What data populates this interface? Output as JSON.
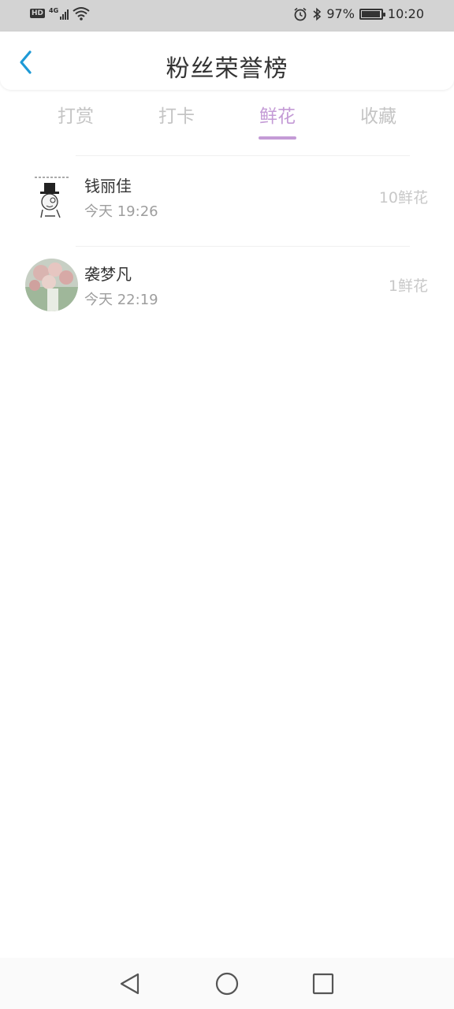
{
  "status_bar": {
    "hd": "HD",
    "network": "4G",
    "battery_percent": "97%",
    "battery_level": 0.97,
    "time": "10:20"
  },
  "header": {
    "title": "粉丝荣誉榜",
    "back_icon": "chevron-left-icon",
    "accent_color": "#1e9ad6"
  },
  "tabs": [
    {
      "label": "打赏",
      "active": false
    },
    {
      "label": "打卡",
      "active": false
    },
    {
      "label": "鲜花",
      "active": true
    },
    {
      "label": "收藏",
      "active": false
    }
  ],
  "active_tab_color": "#c49bd6",
  "list": [
    {
      "name": "钱丽佳",
      "time": "今天 19:26",
      "amount": "10鲜花",
      "avatar": "monocle-meme-avatar"
    },
    {
      "name": "袭梦凡",
      "time": "今天 22:19",
      "amount": "1鲜花",
      "avatar": "flower-photo-avatar"
    }
  ],
  "nav": {
    "back": "back-triangle-icon",
    "home": "home-circle-icon",
    "recents": "recents-square-icon"
  }
}
